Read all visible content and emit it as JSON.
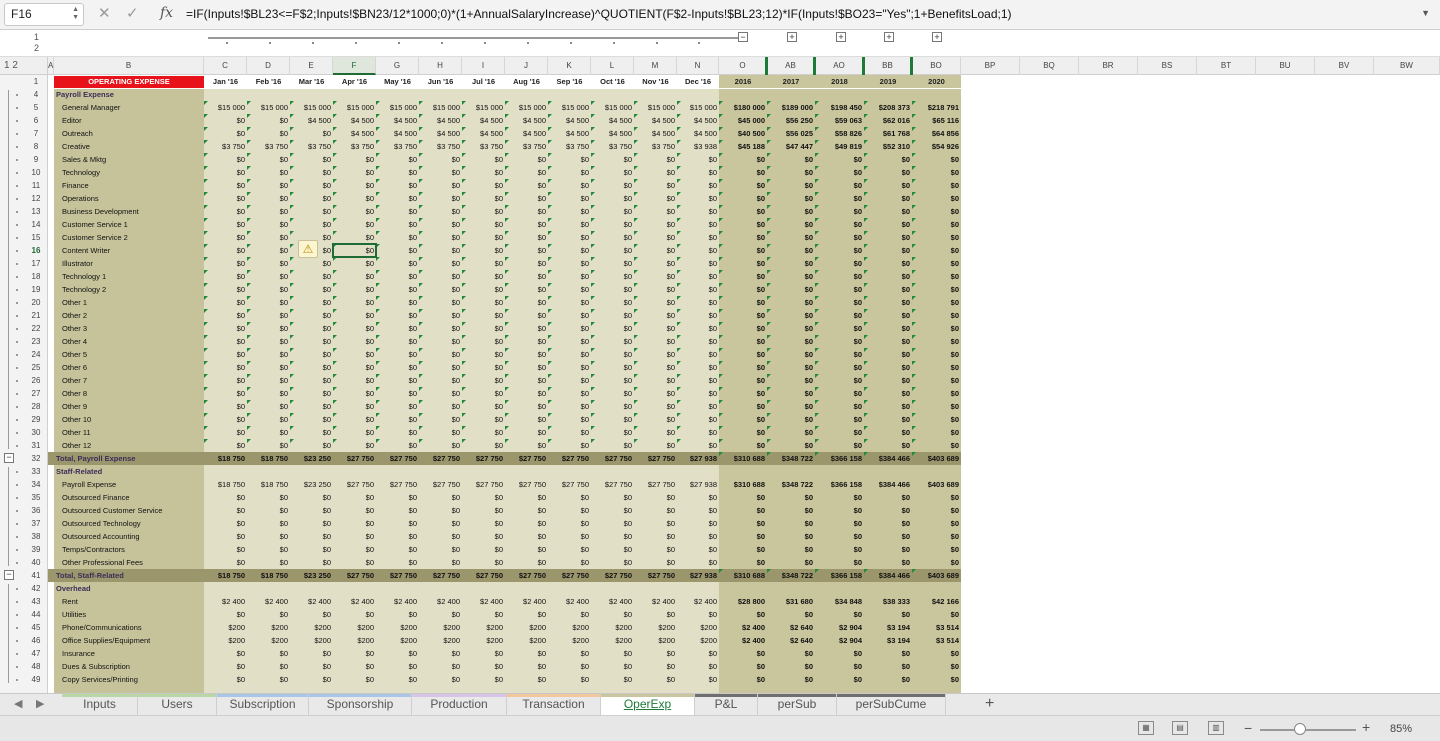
{
  "formula_bar": {
    "name_box": "F16",
    "formula": "=IF(Inputs!$BL23<=F$2;Inputs!$BN23/12*1000;0)*(1+AnnualSalaryIncrease)^QUOTIENT(F$2-Inputs!$BL23;12)*IF(Inputs!$BO23=\"Yes\";1+BenefitsLoad;1)",
    "cancel_icon": "cancel-icon",
    "enter_icon": "check-icon",
    "fx_label": "fx"
  },
  "outline": {
    "levels": [
      "1",
      "2"
    ],
    "collapse_symbol": "−",
    "expand_symbol": "+"
  },
  "column_headers": [
    "A",
    "B",
    "C",
    "D",
    "E",
    "F",
    "G",
    "H",
    "I",
    "J",
    "K",
    "L",
    "M",
    "N",
    "O",
    "AB",
    "AO",
    "BB",
    "BO",
    "BP",
    "BQ",
    "BR",
    "BS",
    "BT",
    "BU",
    "BV",
    "BW"
  ],
  "selected_column": "F",
  "selected_row": "16",
  "sheet": {
    "title": "OPERATING EXPENSE",
    "months": [
      "Jan '16",
      "Feb '16",
      "Mar '16",
      "Apr '16",
      "May '16",
      "Jun '16",
      "Jul '16",
      "Aug '16",
      "Sep '16",
      "Oct '16",
      "Nov '16",
      "Dec '16"
    ],
    "years": [
      "2016",
      "2017",
      "2018",
      "2019",
      "2020"
    ],
    "rows": [
      {
        "r": "4",
        "label": "Payroll Expense",
        "type": "header"
      },
      {
        "r": "5",
        "label": "General Manager",
        "m": [
          "$15 000",
          "$15 000",
          "$15 000",
          "$15 000",
          "$15 000",
          "$15 000",
          "$15 000",
          "$15 000",
          "$15 000",
          "$15 000",
          "$15 000",
          "$15 000"
        ],
        "y": [
          "$180 000",
          "$189 000",
          "$198 450",
          "$208 373",
          "$218 791"
        ]
      },
      {
        "r": "6",
        "label": "Editor",
        "m": [
          "$0",
          "$0",
          "$4 500",
          "$4 500",
          "$4 500",
          "$4 500",
          "$4 500",
          "$4 500",
          "$4 500",
          "$4 500",
          "$4 500",
          "$4 500"
        ],
        "y": [
          "$45 000",
          "$56 250",
          "$59 063",
          "$62 016",
          "$65 116"
        ]
      },
      {
        "r": "7",
        "label": "Outreach",
        "m": [
          "$0",
          "$0",
          "$0",
          "$4 500",
          "$4 500",
          "$4 500",
          "$4 500",
          "$4 500",
          "$4 500",
          "$4 500",
          "$4 500",
          "$4 500"
        ],
        "y": [
          "$40 500",
          "$56 025",
          "$58 826",
          "$61 768",
          "$64 856"
        ]
      },
      {
        "r": "8",
        "label": "Creative",
        "m": [
          "$3 750",
          "$3 750",
          "$3 750",
          "$3 750",
          "$3 750",
          "$3 750",
          "$3 750",
          "$3 750",
          "$3 750",
          "$3 750",
          "$3 750",
          "$3 938"
        ],
        "y": [
          "$45 188",
          "$47 447",
          "$49 819",
          "$52 310",
          "$54 926"
        ]
      },
      {
        "r": "9",
        "label": "Sales & Mktg",
        "zero": true
      },
      {
        "r": "10",
        "label": "Technology",
        "zero": true
      },
      {
        "r": "11",
        "label": "Finance",
        "zero": true
      },
      {
        "r": "12",
        "label": "Operations",
        "zero": true
      },
      {
        "r": "13",
        "label": "Business Development",
        "zero": true
      },
      {
        "r": "14",
        "label": "Customer Service 1",
        "zero": true
      },
      {
        "r": "15",
        "label": "Customer Service 2",
        "zero": true
      },
      {
        "r": "16",
        "label": "Content Writer",
        "zero": true
      },
      {
        "r": "17",
        "label": "Illustrator",
        "zero": true
      },
      {
        "r": "18",
        "label": "Technology 1",
        "zero": true
      },
      {
        "r": "19",
        "label": "Technology 2",
        "zero": true
      },
      {
        "r": "20",
        "label": "Other 1",
        "zero": true
      },
      {
        "r": "21",
        "label": "Other 2",
        "zero": true
      },
      {
        "r": "22",
        "label": "Other 3",
        "zero": true
      },
      {
        "r": "23",
        "label": "Other 4",
        "zero": true
      },
      {
        "r": "24",
        "label": "Other 5",
        "zero": true
      },
      {
        "r": "25",
        "label": "Other 6",
        "zero": true
      },
      {
        "r": "26",
        "label": "Other 7",
        "zero": true
      },
      {
        "r": "27",
        "label": "Other 8",
        "zero": true
      },
      {
        "r": "28",
        "label": "Other 9",
        "zero": true
      },
      {
        "r": "29",
        "label": "Other 10",
        "zero": true
      },
      {
        "r": "30",
        "label": "Other 11",
        "zero": true
      },
      {
        "r": "31",
        "label": "Other 12",
        "zero": true
      },
      {
        "r": "32",
        "label": "Total, Payroll Expense",
        "type": "total",
        "m": [
          "$18 750",
          "$18 750",
          "$23 250",
          "$27 750",
          "$27 750",
          "$27 750",
          "$27 750",
          "$27 750",
          "$27 750",
          "$27 750",
          "$27 750",
          "$27 938"
        ],
        "y": [
          "$310 688",
          "$348 722",
          "$366 158",
          "$384 466",
          "$403 689"
        ]
      },
      {
        "r": "33",
        "label": "Staff-Related",
        "type": "header"
      },
      {
        "r": "34",
        "label": "Payroll Expense",
        "plain": true,
        "m": [
          "$18 750",
          "$18 750",
          "$23 250",
          "$27 750",
          "$27 750",
          "$27 750",
          "$27 750",
          "$27 750",
          "$27 750",
          "$27 750",
          "$27 750",
          "$27 938"
        ],
        "y": [
          "$310 688",
          "$348 722",
          "$366 158",
          "$384 466",
          "$403 689"
        ]
      },
      {
        "r": "35",
        "label": "Outsourced Finance",
        "zero": true,
        "plain": true
      },
      {
        "r": "36",
        "label": "Outsourced Customer Service",
        "zero": true,
        "plain": true
      },
      {
        "r": "37",
        "label": "Outsourced Technology",
        "zero": true,
        "plain": true
      },
      {
        "r": "38",
        "label": "Outsourced Accounting",
        "zero": true,
        "plain": true
      },
      {
        "r": "39",
        "label": "Temps/Contractors",
        "zero": true,
        "plain": true
      },
      {
        "r": "40",
        "label": "Other Professional Fees",
        "zero": true,
        "plain": true
      },
      {
        "r": "41",
        "label": "Total, Staff-Related",
        "type": "total",
        "m": [
          "$18 750",
          "$18 750",
          "$23 250",
          "$27 750",
          "$27 750",
          "$27 750",
          "$27 750",
          "$27 750",
          "$27 750",
          "$27 750",
          "$27 750",
          "$27 938"
        ],
        "y": [
          "$310 688",
          "$348 722",
          "$366 158",
          "$384 466",
          "$403 689"
        ]
      },
      {
        "r": "42",
        "label": "Overhead",
        "type": "header"
      },
      {
        "r": "43",
        "label": "Rent",
        "plain": true,
        "m": [
          "$2 400",
          "$2 400",
          "$2 400",
          "$2 400",
          "$2 400",
          "$2 400",
          "$2 400",
          "$2 400",
          "$2 400",
          "$2 400",
          "$2 400",
          "$2 400"
        ],
        "y": [
          "$28 800",
          "$31 680",
          "$34 848",
          "$38 333",
          "$42 166"
        ]
      },
      {
        "r": "44",
        "label": "Utilities",
        "zero": true,
        "plain": true
      },
      {
        "r": "45",
        "label": "Phone/Communications",
        "plain": true,
        "m": [
          "$200",
          "$200",
          "$200",
          "$200",
          "$200",
          "$200",
          "$200",
          "$200",
          "$200",
          "$200",
          "$200",
          "$200"
        ],
        "y": [
          "$2 400",
          "$2 640",
          "$2 904",
          "$3 194",
          "$3 514"
        ]
      },
      {
        "r": "46",
        "label": "Office Supplies/Equipment",
        "plain": true,
        "m": [
          "$200",
          "$200",
          "$200",
          "$200",
          "$200",
          "$200",
          "$200",
          "$200",
          "$200",
          "$200",
          "$200",
          "$200"
        ],
        "y": [
          "$2 400",
          "$2 640",
          "$2 904",
          "$3 194",
          "$3 514"
        ]
      },
      {
        "r": "47",
        "label": "Insurance",
        "zero": true,
        "plain": true
      },
      {
        "r": "48",
        "label": "Dues & Subscription",
        "zero": true,
        "plain": true
      },
      {
        "r": "49",
        "label": "Copy Services/Printing",
        "zero": true,
        "plain": true
      }
    ],
    "zero_value": "$0"
  },
  "warning_icon": "warning-icon",
  "tabs": [
    {
      "label": "Inputs",
      "color": "#b9d7a5"
    },
    {
      "label": "Users",
      "color": "#b9d7a5"
    },
    {
      "label": "Subscription",
      "color": "#a9c6e8"
    },
    {
      "label": "Sponsorship",
      "color": "#a9c6e8"
    },
    {
      "label": "Production",
      "color": "#d8c4e6"
    },
    {
      "label": "Transaction",
      "color": "#f2c79e"
    },
    {
      "label": "OperExp",
      "color": "#c9c59d",
      "active": true
    },
    {
      "label": "P&L",
      "color": "#6f6f6f"
    },
    {
      "label": "perSub",
      "color": "#6f6f6f"
    },
    {
      "label": "perSubCume",
      "color": "#6f6f6f"
    }
  ],
  "status": {
    "zoom": "85%"
  },
  "colors": {
    "accent": "#1f7a3a",
    "title_bg": "#e8121b",
    "input_green": "#1f8a3a"
  }
}
